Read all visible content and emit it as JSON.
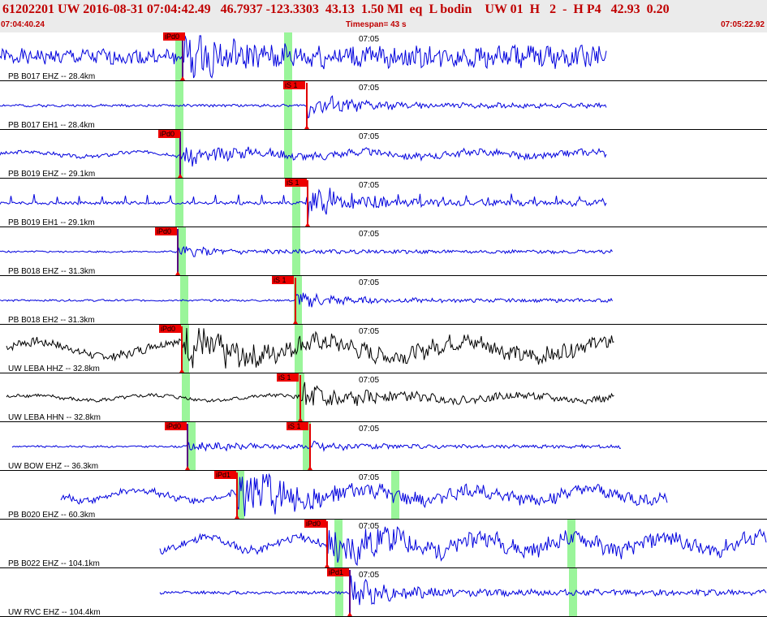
{
  "header": {
    "event_line": "61202201 UW 2016-08-31 07:04:42.49   46.7937 -123.3303  43.13  1.50 Ml  eq  L bodin    UW 01  H   2  -  H P4   42.93  0.20",
    "start_time": "07:04:40.24",
    "timespan": "Timespan=  43 s",
    "end_time": "07:05:22.92"
  },
  "colors": {
    "short_period": "#0000dd",
    "broadband": "#000000",
    "pick_flag": "#ee0000",
    "window": "#9af59a",
    "divider": "#000000"
  },
  "panels": [
    {
      "label": "PB B017 EHZ -- 28.4km",
      "minute_label": "07:05",
      "trace_type": "short_period",
      "picks": [
        {
          "text": "iPd0",
          "color": "red"
        }
      ]
    },
    {
      "label": "PB B017 EH1 -- 28.4km",
      "minute_label": "07:05",
      "trace_type": "short_period",
      "picks": [
        {
          "text": "iS 1",
          "color": "red"
        }
      ]
    },
    {
      "label": "PB B019 EHZ -- 29.1km",
      "minute_label": "07:05",
      "trace_type": "short_period",
      "picks": [
        {
          "text": "iPd0",
          "color": "red"
        }
      ]
    },
    {
      "label": "PB B019 EH1 -- 29.1km",
      "minute_label": "07:05",
      "trace_type": "short_period",
      "picks": [
        {
          "text": "iS 1",
          "color": "red"
        }
      ]
    },
    {
      "label": "PB B018 EHZ -- 31.3km",
      "minute_label": "07:05",
      "trace_type": "short_period",
      "picks": [
        {
          "text": "iPd0",
          "color": "red"
        }
      ]
    },
    {
      "label": "PB B018 EH2 -- 31.3km",
      "minute_label": "07:05",
      "trace_type": "short_period",
      "picks": [
        {
          "text": "iS 1",
          "color": "red"
        }
      ]
    },
    {
      "label": "UW LEBA HHZ -- 32.8km",
      "minute_label": "07:05",
      "trace_type": "broadband",
      "picks": [
        {
          "text": "iPd0",
          "color": "red"
        }
      ]
    },
    {
      "label": "UW LEBA HHN -- 32.8km",
      "minute_label": "07:05",
      "trace_type": "broadband",
      "picks": [
        {
          "text": "iS 1",
          "color": "red"
        }
      ]
    },
    {
      "label": "UW BOW EHZ -- 36.3km",
      "minute_label": "07:05",
      "trace_type": "short_period",
      "picks": [
        {
          "text": "iPd0",
          "color": "red"
        },
        {
          "text": "iS 1",
          "color": "red"
        }
      ]
    },
    {
      "label": "PB B020 EHZ -- 60.3km",
      "minute_label": "07:05",
      "trace_type": "short_period",
      "picks": [
        {
          "text": "iPd1",
          "color": "red"
        }
      ]
    },
    {
      "label": "PB B022 EHZ -- 104.1km",
      "minute_label": "07:05",
      "trace_type": "short_period",
      "picks": [
        {
          "text": "iPd0",
          "color": "red"
        }
      ]
    },
    {
      "label": "UW RVC EHZ -- 104.4km",
      "minute_label": "07:05",
      "trace_type": "short_period",
      "picks": [
        {
          "text": "iPd1",
          "color": "red"
        }
      ]
    }
  ]
}
